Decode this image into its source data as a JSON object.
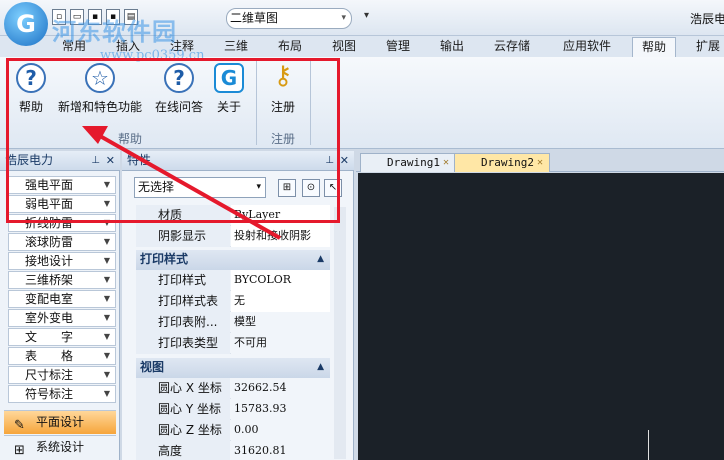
{
  "titlebar": {
    "logo_glyph": "G",
    "qat_icons": [
      "new-file-icon",
      "open-folder-icon",
      "save-icon",
      "save-as-icon",
      "print-icon"
    ],
    "doc_select_value": "二维草图",
    "app_title": "浩辰电"
  },
  "watermark": {
    "text": "河东软件园",
    "url": "www.pc0359.cn"
  },
  "tabs": [
    {
      "label": "常用"
    },
    {
      "label": "插入"
    },
    {
      "label": "注释"
    },
    {
      "label": "三维"
    },
    {
      "label": "布局"
    },
    {
      "label": "视图"
    },
    {
      "label": "管理"
    },
    {
      "label": "输出"
    },
    {
      "label": "云存储"
    },
    {
      "label": "应用软件"
    },
    {
      "label": "帮助"
    },
    {
      "label": "扩展"
    }
  ],
  "active_tab": "帮助",
  "ribbon": {
    "help_group": {
      "label": "帮助",
      "buttons": [
        {
          "label": "帮助",
          "icon": "help-icon",
          "glyph": "?"
        },
        {
          "label": "新增和特色功能",
          "icon": "star-icon",
          "glyph": "☆"
        },
        {
          "label": "在线问答",
          "icon": "online-qa-icon",
          "glyph": "?"
        },
        {
          "label": "关于",
          "icon": "about-logo-icon",
          "glyph": "G"
        }
      ]
    },
    "register_group": {
      "label": "注册",
      "buttons": [
        {
          "label": "注册",
          "icon": "key-icon",
          "glyph": "⚷"
        }
      ]
    }
  },
  "left_panel": {
    "title": "浩辰电力",
    "items": [
      {
        "label": "强电平面"
      },
      {
        "label": "弱电平面"
      },
      {
        "label": "折线防雷"
      },
      {
        "label": "滚球防雷"
      },
      {
        "label": "接地设计"
      },
      {
        "label": "三维桥架"
      },
      {
        "label": "变配电室"
      },
      {
        "label": "室外变电"
      },
      {
        "label": "文　　字"
      },
      {
        "label": "表　　格"
      },
      {
        "label": "尺寸标注"
      },
      {
        "label": "符号标注"
      }
    ],
    "bottom_buttons": [
      {
        "label": "平面设计",
        "icon": "pencil-icon"
      },
      {
        "label": "系统设计",
        "icon": "system-icon"
      }
    ]
  },
  "properties": {
    "title": "特性",
    "selection": "无选择",
    "general_rows": [
      {
        "key": "材质",
        "value": "ByLayer"
      },
      {
        "key": "阴影显示",
        "value": "投射和接收阴影"
      }
    ],
    "print_style_section": "打印样式",
    "print_rows": [
      {
        "key": "打印样式",
        "value": "BYCOLOR"
      },
      {
        "key": "打印样式表",
        "value": "无"
      },
      {
        "key": "打印表附...",
        "value": "模型"
      },
      {
        "key": "打印表类型",
        "value": "不可用"
      }
    ],
    "view_section": "视图",
    "view_rows": [
      {
        "key": "圆心 X 坐标",
        "value": "32662.54"
      },
      {
        "key": "圆心 Y 坐标",
        "value": "15783.93"
      },
      {
        "key": "圆心 Z 坐标",
        "value": "0.00"
      },
      {
        "key": "高度",
        "value": "31620.81"
      }
    ]
  },
  "drawing_tabs": [
    {
      "label": "Drawing1"
    },
    {
      "label": "Drawing2"
    }
  ],
  "colors": {
    "highlight_red": "#e5192c",
    "canvas": "#1b2128",
    "active_tab_bg": "#ffe7a6"
  }
}
